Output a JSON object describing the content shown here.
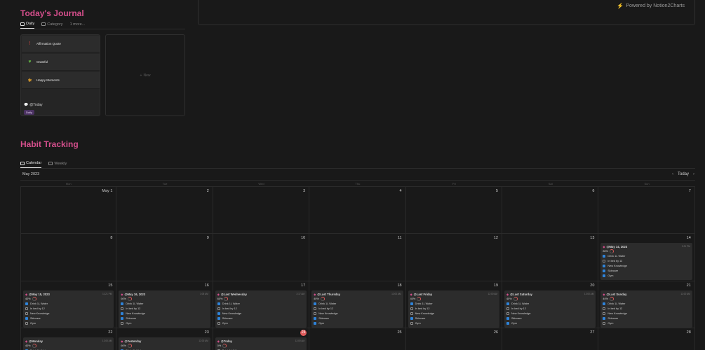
{
  "embed": {
    "powered_by": "Powered by Notion2Charts"
  },
  "journal": {
    "title": "Today's Journal",
    "tabs": [
      {
        "label": "Daily",
        "active": true
      },
      {
        "label": "Category",
        "active": false
      },
      {
        "label": "1 more...",
        "active": false
      }
    ],
    "card": {
      "properties": [
        {
          "icon": "exclamation-icon",
          "label": "Affirmation Quote"
        },
        {
          "icon": "heart-icon",
          "label": "Grateful"
        },
        {
          "icon": "star-icon",
          "label": "Happy Moments"
        }
      ],
      "title": "@Today",
      "tag": "Daily"
    },
    "new_label": "New"
  },
  "habit": {
    "title": "Habit Tracking",
    "tabs": [
      {
        "label": "Calendar",
        "active": true
      },
      {
        "label": "Weekly",
        "active": false
      }
    ],
    "month": "May 2023",
    "today_button": "Today",
    "weekdays": [
      "Mon",
      "Tue",
      "Wed",
      "Thu",
      "Fri",
      "Sat",
      "Sun"
    ],
    "habit_names": [
      "Drink 1L Water",
      "In bed by 12",
      "New Knowledge",
      "Skincare",
      "Gym"
    ],
    "weeks": [
      {
        "days": [
          {
            "num": "May 1"
          },
          {
            "num": "2"
          },
          {
            "num": "3"
          },
          {
            "num": "4"
          },
          {
            "num": "5"
          },
          {
            "num": "6"
          },
          {
            "num": "7"
          }
        ]
      },
      {
        "days": [
          {
            "num": "8"
          },
          {
            "num": "9"
          },
          {
            "num": "10"
          },
          {
            "num": "11"
          },
          {
            "num": "12"
          },
          {
            "num": "13"
          },
          {
            "num": "14",
            "entry": {
              "title": "@May 14, 2023",
              "time": "3:21 PM",
              "pct": "80%",
              "checks": [
                true,
                false,
                true,
                true,
                true
              ]
            }
          }
        ]
      },
      {
        "days": [
          {
            "num": "15",
            "entry": {
              "title": "@May 15, 2023",
              "time": "11:21 PM",
              "pct": "40%",
              "checks": [
                true,
                false,
                false,
                true,
                false
              ]
            }
          },
          {
            "num": "16",
            "entry": {
              "title": "@May 16, 2023",
              "time": "3:05 AM",
              "pct": "60%",
              "checks": [
                true,
                false,
                true,
                true,
                false
              ]
            }
          },
          {
            "num": "17",
            "entry": {
              "title": "@Last Wednesday",
              "time": "2:17 AM",
              "pct": "60%",
              "checks": [
                true,
                false,
                true,
                true,
                false
              ]
            }
          },
          {
            "num": "18",
            "entry": {
              "title": "@Last Thursday",
              "time": "12:00 AM",
              "pct": "40%",
              "checks": [
                true,
                false,
                false,
                true,
                true
              ]
            }
          },
          {
            "num": "19",
            "entry": {
              "title": "@Last Friday",
              "time": "12:00 AM",
              "pct": "40%",
              "checks": [
                true,
                false,
                false,
                true,
                false
              ]
            }
          },
          {
            "num": "20",
            "entry": {
              "title": "@Last Saturday",
              "time": "12:00 AM",
              "pct": "40%",
              "checks": [
                true,
                false,
                false,
                true,
                true
              ]
            }
          },
          {
            "num": "21",
            "entry": {
              "title": "@Last Sunday",
              "time": "12:00 AM",
              "pct": "40%",
              "checks": [
                true,
                false,
                false,
                true,
                false
              ]
            }
          }
        ]
      },
      {
        "days": [
          {
            "num": "22",
            "entry": {
              "title": "@Monday",
              "time": "12:00 AM",
              "pct": "40%",
              "checks": [
                true
              ]
            }
          },
          {
            "num": "23",
            "entry": {
              "title": "@Yesterday",
              "time": "12:00 AM",
              "pct": "60%",
              "checks": [
                true
              ]
            }
          },
          {
            "num": "24",
            "today": true,
            "entry": {
              "title": "@Today",
              "time": "12:00 AM",
              "pct": "0%",
              "checks": [
                false
              ]
            }
          },
          {
            "num": "25"
          },
          {
            "num": "26"
          },
          {
            "num": "27"
          },
          {
            "num": "28"
          }
        ]
      }
    ]
  }
}
